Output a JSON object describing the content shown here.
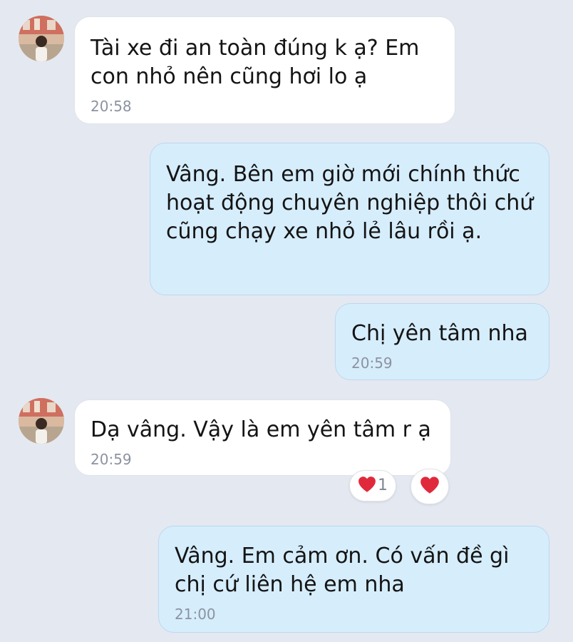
{
  "messages": [
    {
      "direction": "incoming",
      "text": "Tài xe đi an toàn đúng k ạ? Em con nhỏ nên cũng hơi lo ạ",
      "time": "20:58"
    },
    {
      "direction": "outgoing",
      "text": "Vâng. Bên em giờ mới chính thức hoạt động chuyên nghiệp thôi chứ cũng chạy xe nhỏ lẻ lâu rồi ạ."
    },
    {
      "direction": "outgoing",
      "text": "Chị yên tâm nha",
      "time": "20:59"
    },
    {
      "direction": "incoming",
      "text": "Dạ vâng. Vậy là em yên tâm r ạ",
      "time": "20:59",
      "reactions": [
        {
          "icon": "heart-icon",
          "count": "1"
        },
        {
          "icon": "heart-icon"
        }
      ]
    },
    {
      "direction": "outgoing",
      "text": "Vâng. Em cảm ơn. Có vấn đề gì chị cứ liên hệ em nha",
      "time": "21:00"
    }
  ],
  "colors": {
    "background": "#e4e8f1",
    "incoming_bubble": "#ffffff",
    "outgoing_bubble": "#d6edfc",
    "timestamp": "#8c93a0",
    "heart": "#e02a3c"
  }
}
